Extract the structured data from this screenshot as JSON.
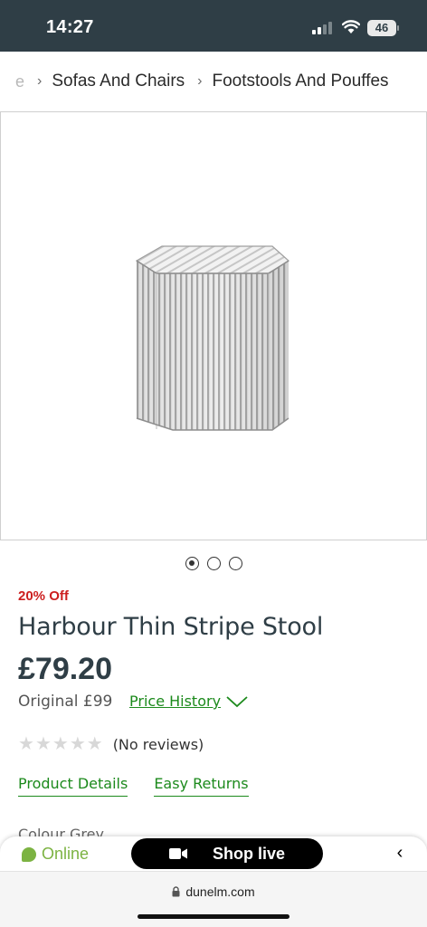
{
  "status_bar": {
    "time": "14:27",
    "battery": "46"
  },
  "breadcrumb": {
    "truncated": "e",
    "items": [
      "Sofas And Chairs",
      "Footstools And Pouffes"
    ]
  },
  "product": {
    "discount": "20% Off",
    "title": "Harbour Thin Stripe Stool",
    "price": "£79.20",
    "original_price": "Original £99",
    "price_history_label": "Price History",
    "rating": {
      "stars": 0,
      "max": 5,
      "reviews_text": "(No reviews)"
    },
    "links": {
      "details": "Product Details",
      "returns": "Easy Returns"
    },
    "colour_partial": "Colour   Grey",
    "carousel": {
      "count": 3,
      "active": 1
    }
  },
  "float_bar": {
    "online": "Online",
    "shop_live": "Shop live"
  },
  "browser": {
    "url": "dunelm.com"
  },
  "colors": {
    "accent_green": "#1c8a1c",
    "sale_red": "#cc1f1f",
    "header_bg": "#2f3e46",
    "online_green": "#7cb342"
  },
  "icons": [
    "signal-icon",
    "wifi-icon",
    "battery-icon",
    "chevron-right-icon",
    "chevron-down-icon",
    "star-icon",
    "video-camera-icon",
    "chevron-left-icon",
    "lock-icon"
  ]
}
